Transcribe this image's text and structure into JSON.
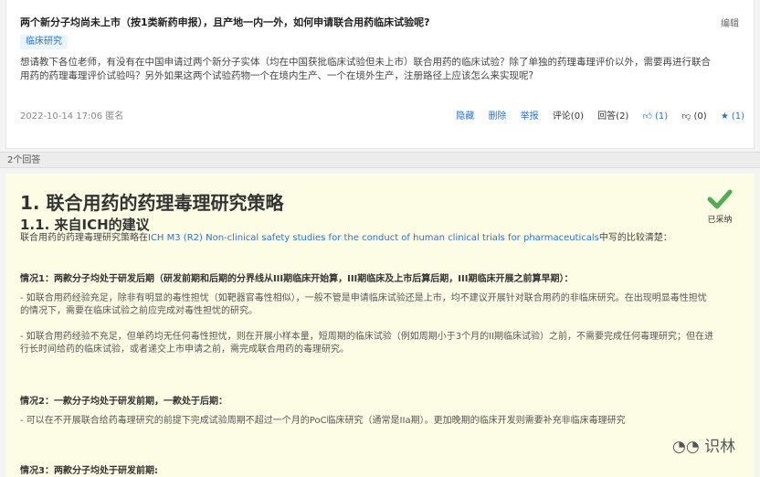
{
  "question": {
    "title": "两个新分子均尚未上市（按1类新药申报），且产地一内一外，如何申请联合用药临床试验呢?",
    "edit_label": "编辑",
    "tag": "临床研究",
    "body": "想请教下各位老师，有没有在中国申请过两个新分子实体（均在中国获批临床试验但未上市）联合用药的临床试验？除了单独的药理毒理评价以外，需要再进行联合用药的药理毒理评价试验吗？另外如果这两个试验药物一个在境内生产、一个在境外生产，注册路径上应该怎么来实现呢?",
    "date": "2022-10-14 17:06",
    "author": "匿名",
    "actions": {
      "hide": "隐藏",
      "delete": "删除",
      "report": "举报",
      "comments": "评论(0)",
      "answers": "回答(2)",
      "upvotes": "(1)",
      "downvotes": "(0)",
      "favorites": "(1)"
    }
  },
  "answer_count": "2个回答",
  "answer": {
    "heading1": "1. 联合用药的药理毒理研究策略",
    "heading2": "1.1. 来自ICH的建议",
    "adopted_label": "已采纳",
    "intro_before": "联合用药的药理毒理研究策略在",
    "intro_link": "ICH M3 (R2) Non-clinical safety studies for the conduct of human clinical trials for pharmaceuticals",
    "intro_after": "中写的比较清楚：",
    "case1_heading": "情况1：两款分子均处于研发后期（研发前期和后期的分界线从III期临床开始算，III期临床及上市后算后期，III期临床开展之前算早期）：",
    "case1_p1": "- 如联合用药经验充足，除非有明显的毒性担忧（如靶器官毒性相似），一般不管是申请临床试验还是上市，均不建议开展针对联合用药的非临床研究。在出现明显毒性担忧的情况下，需要在临床试验之前应完成对毒性担忧的研究。",
    "case1_p2": "- 如联合用药经验不充足，但单药均无任何毒性担忧，则在开展小样本量，短周期的临床试验（例如周期小于3个月的II期临床试验）之前，不需要完成任何毒理研究；但在进行长时间给药的临床试验，或者递交上市申请之前，需完成联合用药的毒理研究。",
    "case2_heading": "情况2：一款分子均处于研发前期，一款处于后期：",
    "case2_p1": "- 可以在不开展联合给药毒理研究的前提下完成试验周期不超过一个月的PoC临床研究（通常是IIa期）。更加晚期的临床开发则需要补充非临床毒理研究",
    "case3_heading": "情况3：两款分子均处于研发前期:"
  },
  "watermark": "识林",
  "colors": {
    "accent": "#2a74c9",
    "adopted": "#4caf50",
    "answer_bg": "#fdfde5"
  }
}
